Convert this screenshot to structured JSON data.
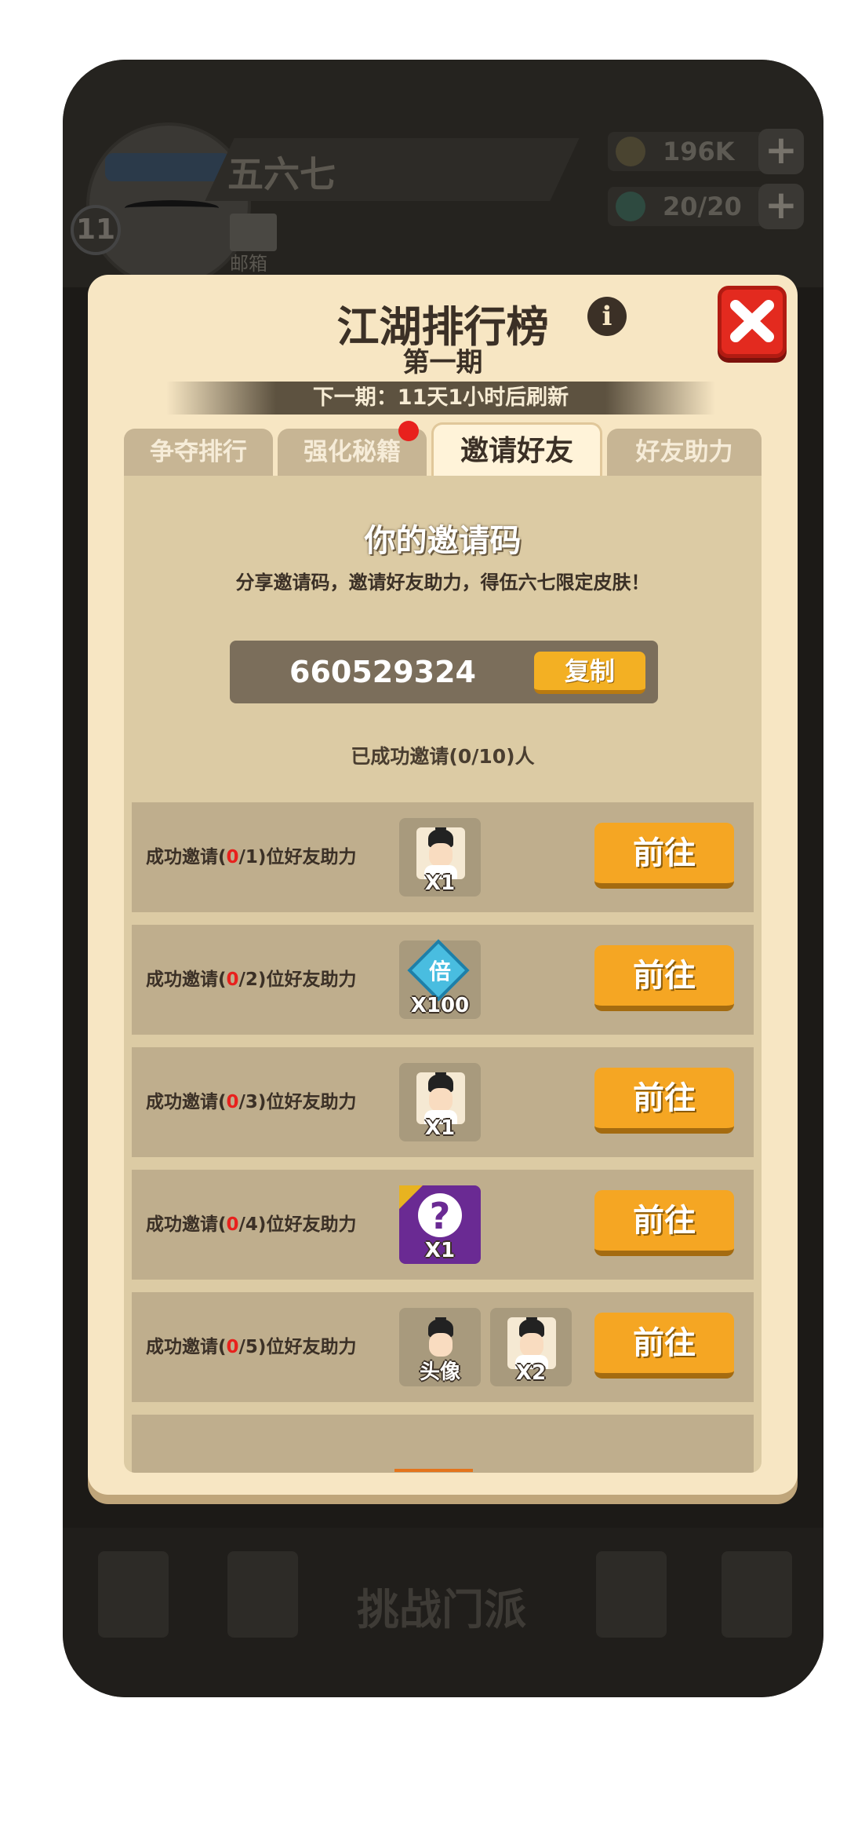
{
  "background": {
    "player_name": "五六七",
    "level": "11",
    "mail_label": "邮箱",
    "gold": "196K",
    "energy": "20/20",
    "challenge_label": "挑战门派"
  },
  "modal": {
    "title": "江湖排行榜",
    "subtitle": "第一期",
    "refresh_text": "下一期：11天1小时后刷新",
    "tabs": [
      "争夺排行",
      "强化秘籍",
      "邀请好友",
      "好友助力"
    ],
    "active_tab": "邀请好友",
    "code_title": "你的邀请码",
    "code_desc": "分享邀请码，邀请好友助力，得伍六七限定皮肤！",
    "invite_code": "660529324",
    "copy_label": "复制",
    "invited_text": "已成功邀请(0/10)人",
    "go_label": "前往",
    "rows": [
      {
        "prefix": "成功邀请(",
        "done": "0",
        "suffix": "/1)位好友助力",
        "rewards": [
          {
            "type": "character",
            "count": "X1"
          }
        ]
      },
      {
        "prefix": "成功邀请(",
        "done": "0",
        "suffix": "/2)位好友助力",
        "rewards": [
          {
            "type": "multiplier",
            "glyph": "倍",
            "count": "X100"
          }
        ]
      },
      {
        "prefix": "成功邀请(",
        "done": "0",
        "suffix": "/3)位好友助力",
        "rewards": [
          {
            "type": "character",
            "count": "X1"
          }
        ]
      },
      {
        "prefix": "成功邀请(",
        "done": "0",
        "suffix": "/4)位好友助力",
        "rewards": [
          {
            "type": "mystery",
            "count": "X1"
          }
        ]
      },
      {
        "prefix": "成功邀请(",
        "done": "0",
        "suffix": "/5)位好友助力",
        "rewards": [
          {
            "type": "avatar",
            "count": "头像"
          },
          {
            "type": "character",
            "count": "X2"
          }
        ]
      }
    ]
  },
  "colors": {
    "modal_bg": "#f7e6c3",
    "panel_bg": "#dccba4",
    "button_orange": "#f5a623",
    "close_red": "#e32a1f",
    "highlight_red": "#e8211d"
  }
}
